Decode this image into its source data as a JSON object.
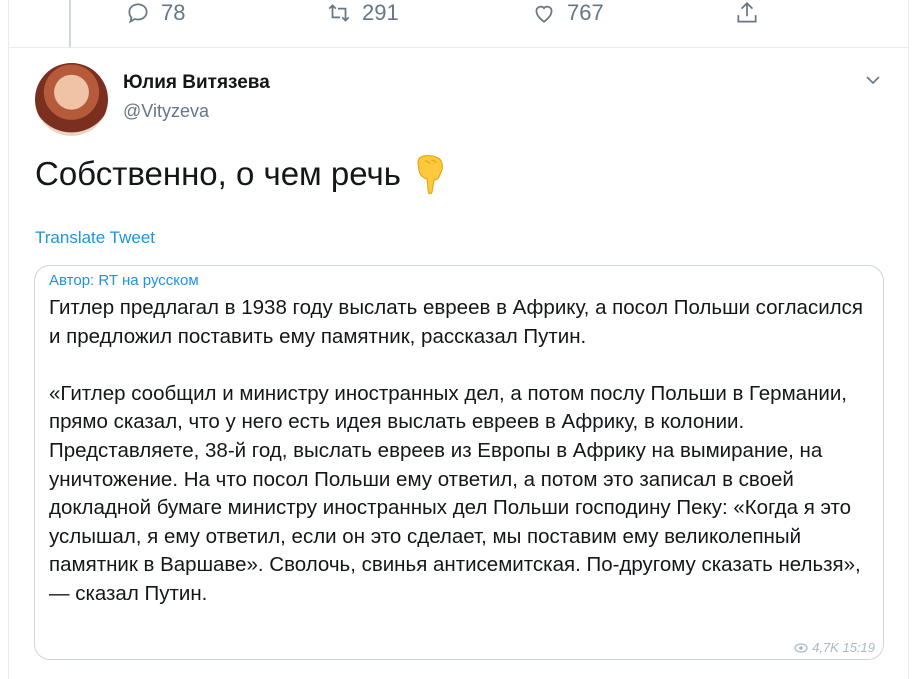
{
  "actions": {
    "reply_count": "78",
    "retweet_count": "291",
    "like_count": "767"
  },
  "tweet": {
    "author_name": "Юлия Витязева",
    "author_handle": "@Vityzeva",
    "text": "Собственно, о чем речь",
    "emoji": "pointing-down-hand-icon",
    "translate_label": "Translate Tweet"
  },
  "quote": {
    "author_label": "Автор: RT на русском",
    "text": "Гитлер предлагал в 1938 году выслать евреев в Африку, а посол Польши согласился и предложил поставить ему памятник, рассказал Путин.\n\n«Гитлер сообщил и министру иностранных дел, а потом послу Польши в Германии, прямо сказал, что у него есть идея выслать евреев в Африку, в колонии. Представляете, 38-й год, выслать евреев из Европы в Африку на вымирание, на уничтожение. На что посол Польши ему ответил, а потом это записал в своей докладной бумаге министру иностранных дел Польши господину Пеку: «Когда я это услышал, я ему ответил, если он это сделает, мы поставим ему великолепный памятник в Варшаве». Сволочь, свинья антисемитская. По-другому сказать нельзя», — сказал Путин.",
    "views": "4,7K 15:19"
  },
  "colors": {
    "link": "#1b95e0",
    "secondary_text": "#657786",
    "border": "#ccd6dd"
  }
}
